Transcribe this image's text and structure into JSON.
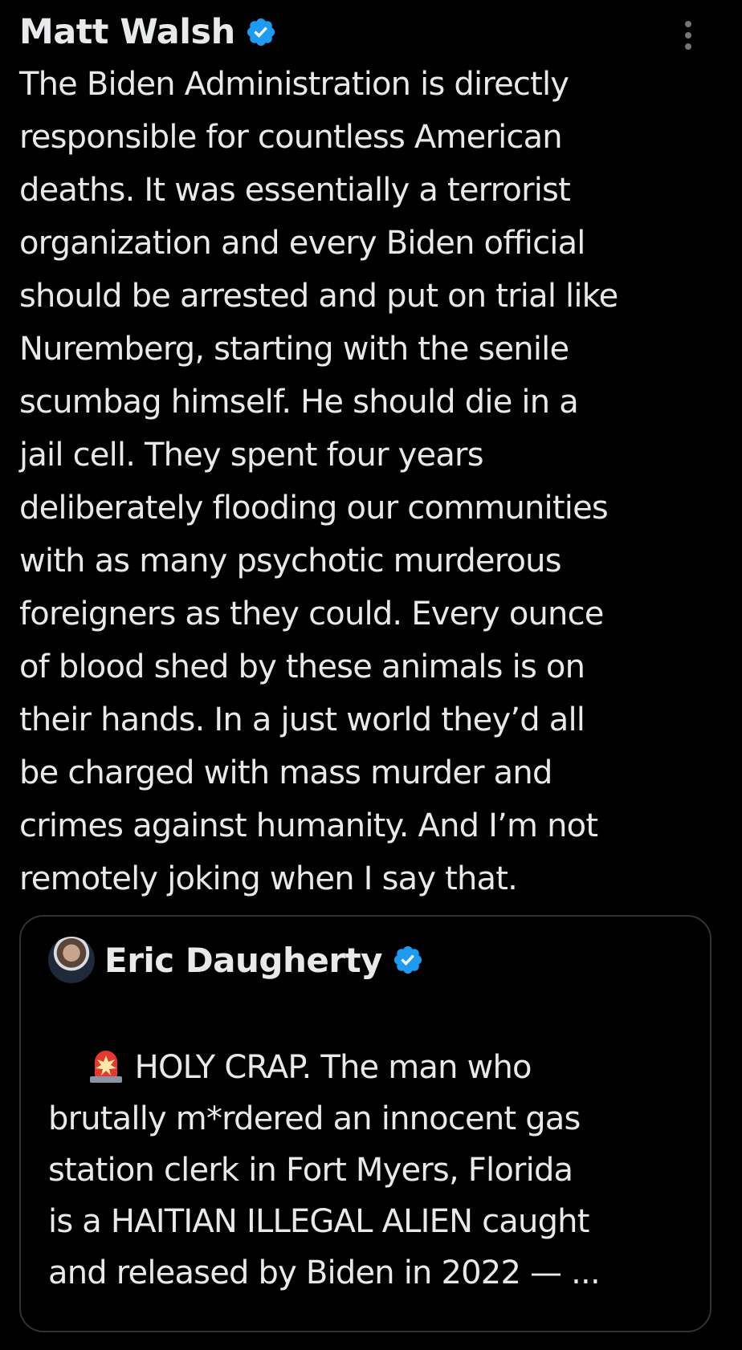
{
  "post": {
    "author_name": "Matt Walsh",
    "verified_icon": "verified-badge-icon",
    "more_icon": "more-options-icon",
    "text": "The Biden Administration is directly\nresponsible for countless American\ndeaths. It was essentially a terrorist\norganization and every Biden official\nshould be arrested and put on trial like\nNuremberg, starting with the senile\nscumbag himself. He should die in a\njail cell. They spent four years\ndeliberately flooding our communities\nwith as many psychotic murderous\nforeigners as they could. Every ounce\nof blood shed by these animals is on\ntheir hands. In a just world they’d all\nbe charged with mass murder and\ncrimes against humanity. And I’m not\nremotely joking when I say that."
  },
  "quote": {
    "author_name": "Eric Daugherty",
    "avatar_icon": "avatar",
    "verified_icon": "verified-badge-icon",
    "siren_icon": "police-siren-icon",
    "text": "HOLY CRAP. The man who\nbrutally m*rdered an innocent gas\nstation clerk in Fort Myers, Florida\nis a HAITIAN ILLEGAL ALIEN caught\nand released by Biden in 2022 — ..."
  },
  "colors": {
    "background": "#000000",
    "text": "#e7e9ea",
    "verified": "#1d9bf0",
    "border": "#2f3336",
    "icon_gray": "#71767b"
  }
}
